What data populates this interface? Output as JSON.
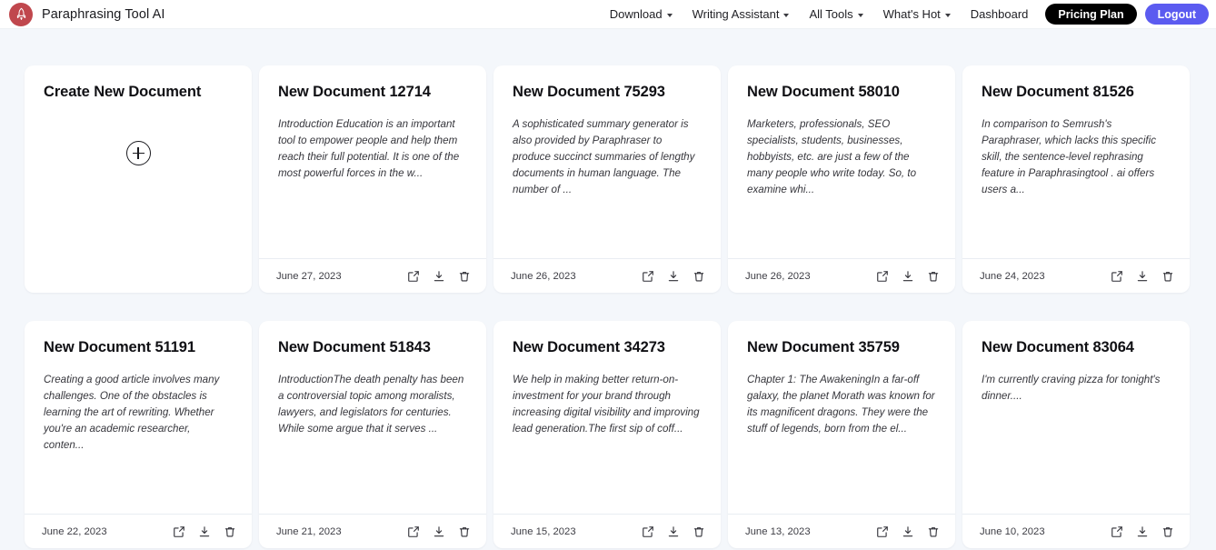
{
  "header": {
    "brand_name": "Paraphrasing Tool AI",
    "logo_icon": "rocket-icon",
    "nav_items": [
      {
        "label": "Download",
        "has_caret": true
      },
      {
        "label": "Writing Assistant",
        "has_caret": true
      },
      {
        "label": "All Tools",
        "has_caret": true
      },
      {
        "label": "What's Hot",
        "has_caret": true
      },
      {
        "label": "Dashboard",
        "has_caret": false
      }
    ],
    "pricing_button": "Pricing Plan",
    "logout_button": "Logout",
    "colors": {
      "logo_bg": "#c0474d",
      "pricing_bg": "#000000",
      "logout_bg": "#5b5bf0",
      "page_bg": "#f4f7fb",
      "card_bg": "#ffffff"
    }
  },
  "create_card": {
    "title": "Create New Document",
    "plus_icon": "plus-circle-icon"
  },
  "action_icons": {
    "open": "external-link-icon",
    "download": "download-icon",
    "delete": "trash-icon"
  },
  "documents": [
    {
      "title": "New Document 12714",
      "excerpt": "Introduction Education is an important tool to empower people and help them reach their full potential. It is one of the most powerful forces in the w...",
      "date": "June 27, 2023"
    },
    {
      "title": "New Document 75293",
      "excerpt": "A sophisticated summary generator is also provided by Paraphraser to produce succinct summaries of lengthy documents in human language. The number of ...",
      "date": "June 26, 2023"
    },
    {
      "title": "New Document 58010",
      "excerpt": "Marketers, professionals, SEO specialists, students, businesses, hobbyists, etc. are just a few of the many people who write today. So, to examine whi...",
      "date": "June 26, 2023"
    },
    {
      "title": "New Document 81526",
      "excerpt": "In comparison to Semrush's Paraphraser, which lacks this specific skill, the sentence-level rephrasing feature in Paraphrasingtool . ai offers users a...",
      "date": "June 24, 2023"
    },
    {
      "title": "New Document 51191",
      "excerpt": "Creating a good article involves many challenges. One of the obstacles is learning the art of rewriting. Whether you're an academic researcher, conten...",
      "date": "June 22, 2023"
    },
    {
      "title": "New Document 51843",
      "excerpt": "IntroductionThe death penalty has been a controversial topic among moralists, lawyers, and legislators for centuries. While some argue that it serves ...",
      "date": "June 21, 2023"
    },
    {
      "title": "New Document 34273",
      "excerpt": "We help in making better return-on-investment for your brand through increasing digital visibility and improving lead generation.The first sip of coff...",
      "date": "June 15, 2023"
    },
    {
      "title": "New Document 35759",
      "excerpt": "Chapter 1: The AwakeningIn a far-off galaxy, the planet Morath was known for its magnificent dragons. They were the stuff of legends, born from the el...",
      "date": "June 13, 2023"
    },
    {
      "title": "New Document 83064",
      "excerpt": "I'm currently craving pizza for tonight's dinner....",
      "date": "June 10, 2023"
    }
  ]
}
